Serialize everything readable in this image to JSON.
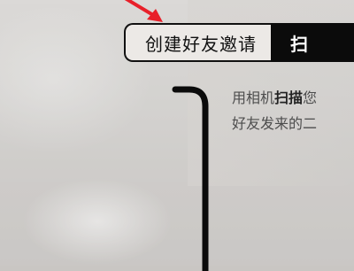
{
  "tabs": {
    "create_invite": "创建好友邀请",
    "scan": "扫"
  },
  "description": {
    "line1_prefix": "用相机",
    "line1_bold": "扫描",
    "line1_suffix": "您",
    "line2": "好友发来的二"
  },
  "colors": {
    "annotation_arrow": "#e8202a",
    "tab_border": "#111111",
    "active_tab_bg": "#0b0b0b"
  },
  "icons": {
    "arrow": "red-arrow-icon"
  }
}
